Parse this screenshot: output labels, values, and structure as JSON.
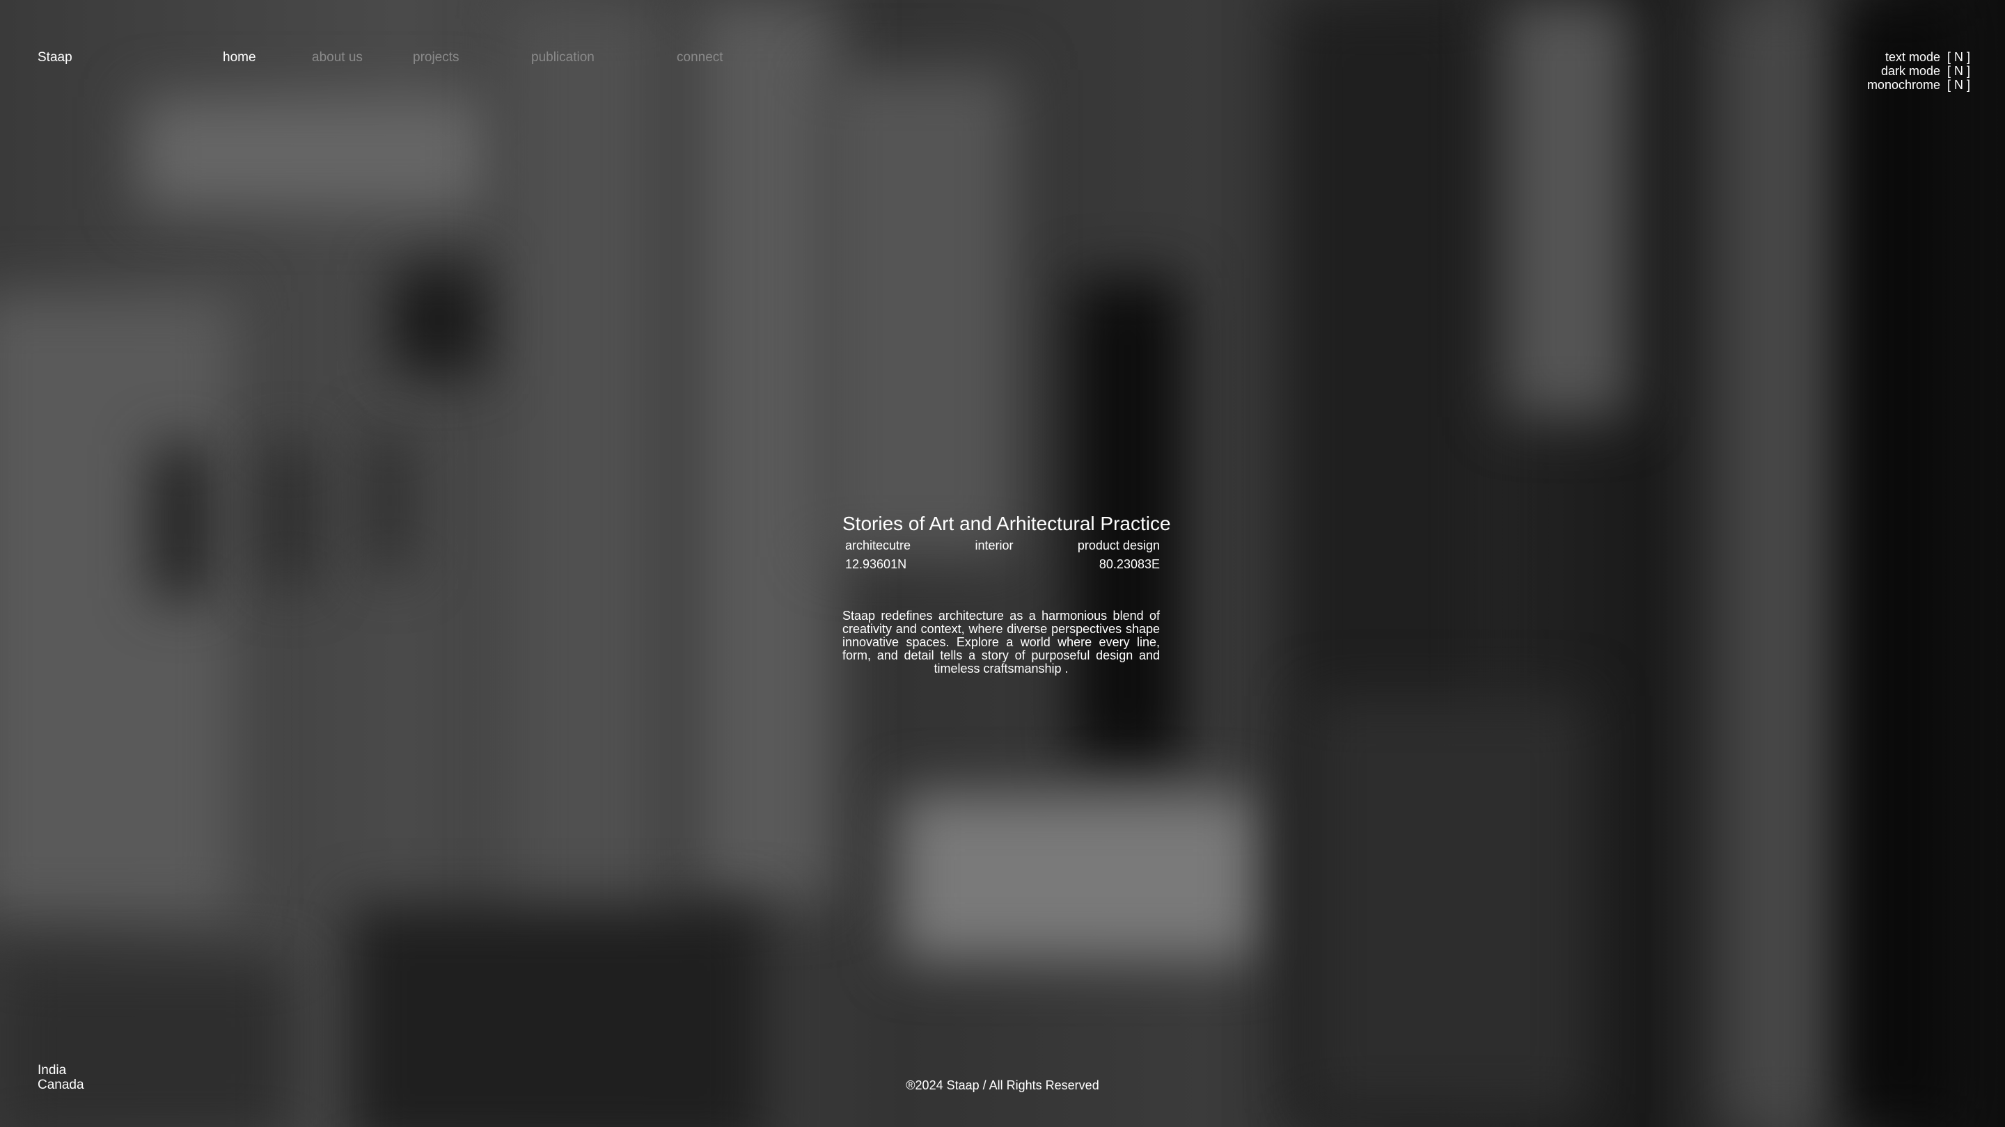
{
  "header": {
    "brand": "Staap",
    "nav": {
      "home": "home",
      "about": "about us",
      "projects": "projects",
      "publication": "publication",
      "connect": "connect"
    },
    "active_nav": "home"
  },
  "toggles": {
    "text_mode": {
      "label": "text mode",
      "state": "[ N ]"
    },
    "dark_mode": {
      "label": "dark mode",
      "state": "[ N ]"
    },
    "monochrome": {
      "label": "monochrome",
      "state": "[ N ]"
    }
  },
  "hero": {
    "title": "Stories of Art and Arhitectural Practice",
    "disciplines": [
      "architecutre",
      "interior",
      "product design"
    ],
    "latitude": "12.93601N",
    "longitude": "80.23083E",
    "description": "Staap redefines architecture as a harmonious blend of creativity and context, where diverse perspectives shape innovative spaces. Explore a world where every line, form, and detail tells a story of purposeful design and timeless craftsmanship ."
  },
  "footer": {
    "locations": [
      "India",
      "Canada"
    ],
    "copyright": "®2024 Staap / All Rights Reserved"
  },
  "colors": {
    "text": "#ffffff",
    "nav_inactive": "#8a8a8a",
    "background": "#3c3c3c"
  }
}
